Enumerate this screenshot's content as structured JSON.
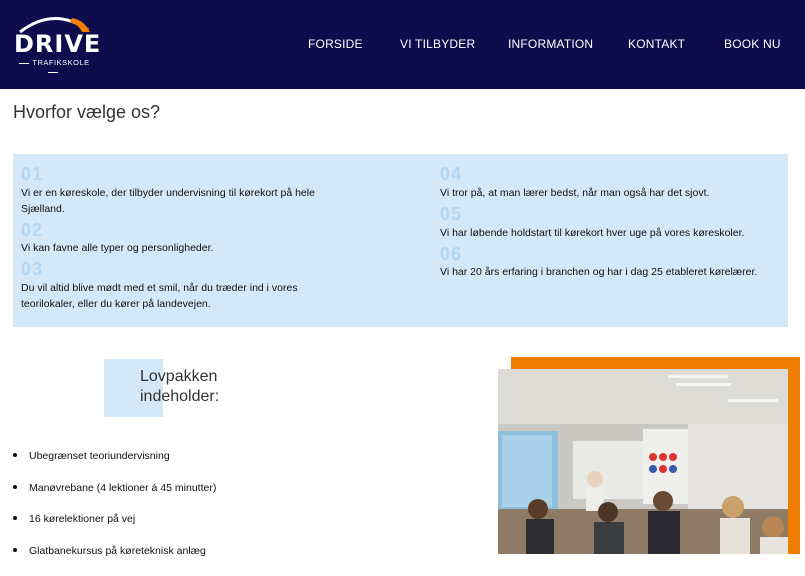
{
  "header": {
    "logo_word": "DRIVE",
    "logo_sub": "TRAFIKSKOLE",
    "nav": [
      "FORSIDE",
      "VI TILBYDER",
      "INFORMATION",
      "KONTAKT",
      "BOOK NU"
    ]
  },
  "why": {
    "title": "Hvorfor vælge os?",
    "items": [
      {
        "num": "01",
        "text": "Vi er en køreskole, der tilbyder undervisning til kørekort på hele Sjælland."
      },
      {
        "num": "02",
        "text": "Vi kan favne alle typer og personligheder."
      },
      {
        "num": "03",
        "text": "Du vil altid blive mødt med et smil, når du træder ind i vores teorilokaler, eller du kører på landevejen."
      },
      {
        "num": "04",
        "text": "Vi tror på, at man lærer bedst, når man også har det sjovt."
      },
      {
        "num": "05",
        "text": "Vi har løbende holdstart til kørekort hver uge på vores køreskoler."
      },
      {
        "num": "06",
        "text": "Vi har 20 års erfaring i branchen og har i dag 25 etableret kørelærer."
      }
    ]
  },
  "package": {
    "title_line1": "Lovpakken",
    "title_line2": "indeholder:",
    "bullets": [
      "Ubegrænset teoriundervisning",
      "Manøvrebane (4 lektioner á 45 minutter)",
      "16 kørelektioner på vej",
      "Glatbanekursus på køreteknisk anlæg"
    ]
  },
  "colors": {
    "header_bg": "#0e0c4c",
    "panel_bg": "#d5e8f7",
    "number": "#b3d7f2",
    "accent_orange": "#ef7d00"
  }
}
